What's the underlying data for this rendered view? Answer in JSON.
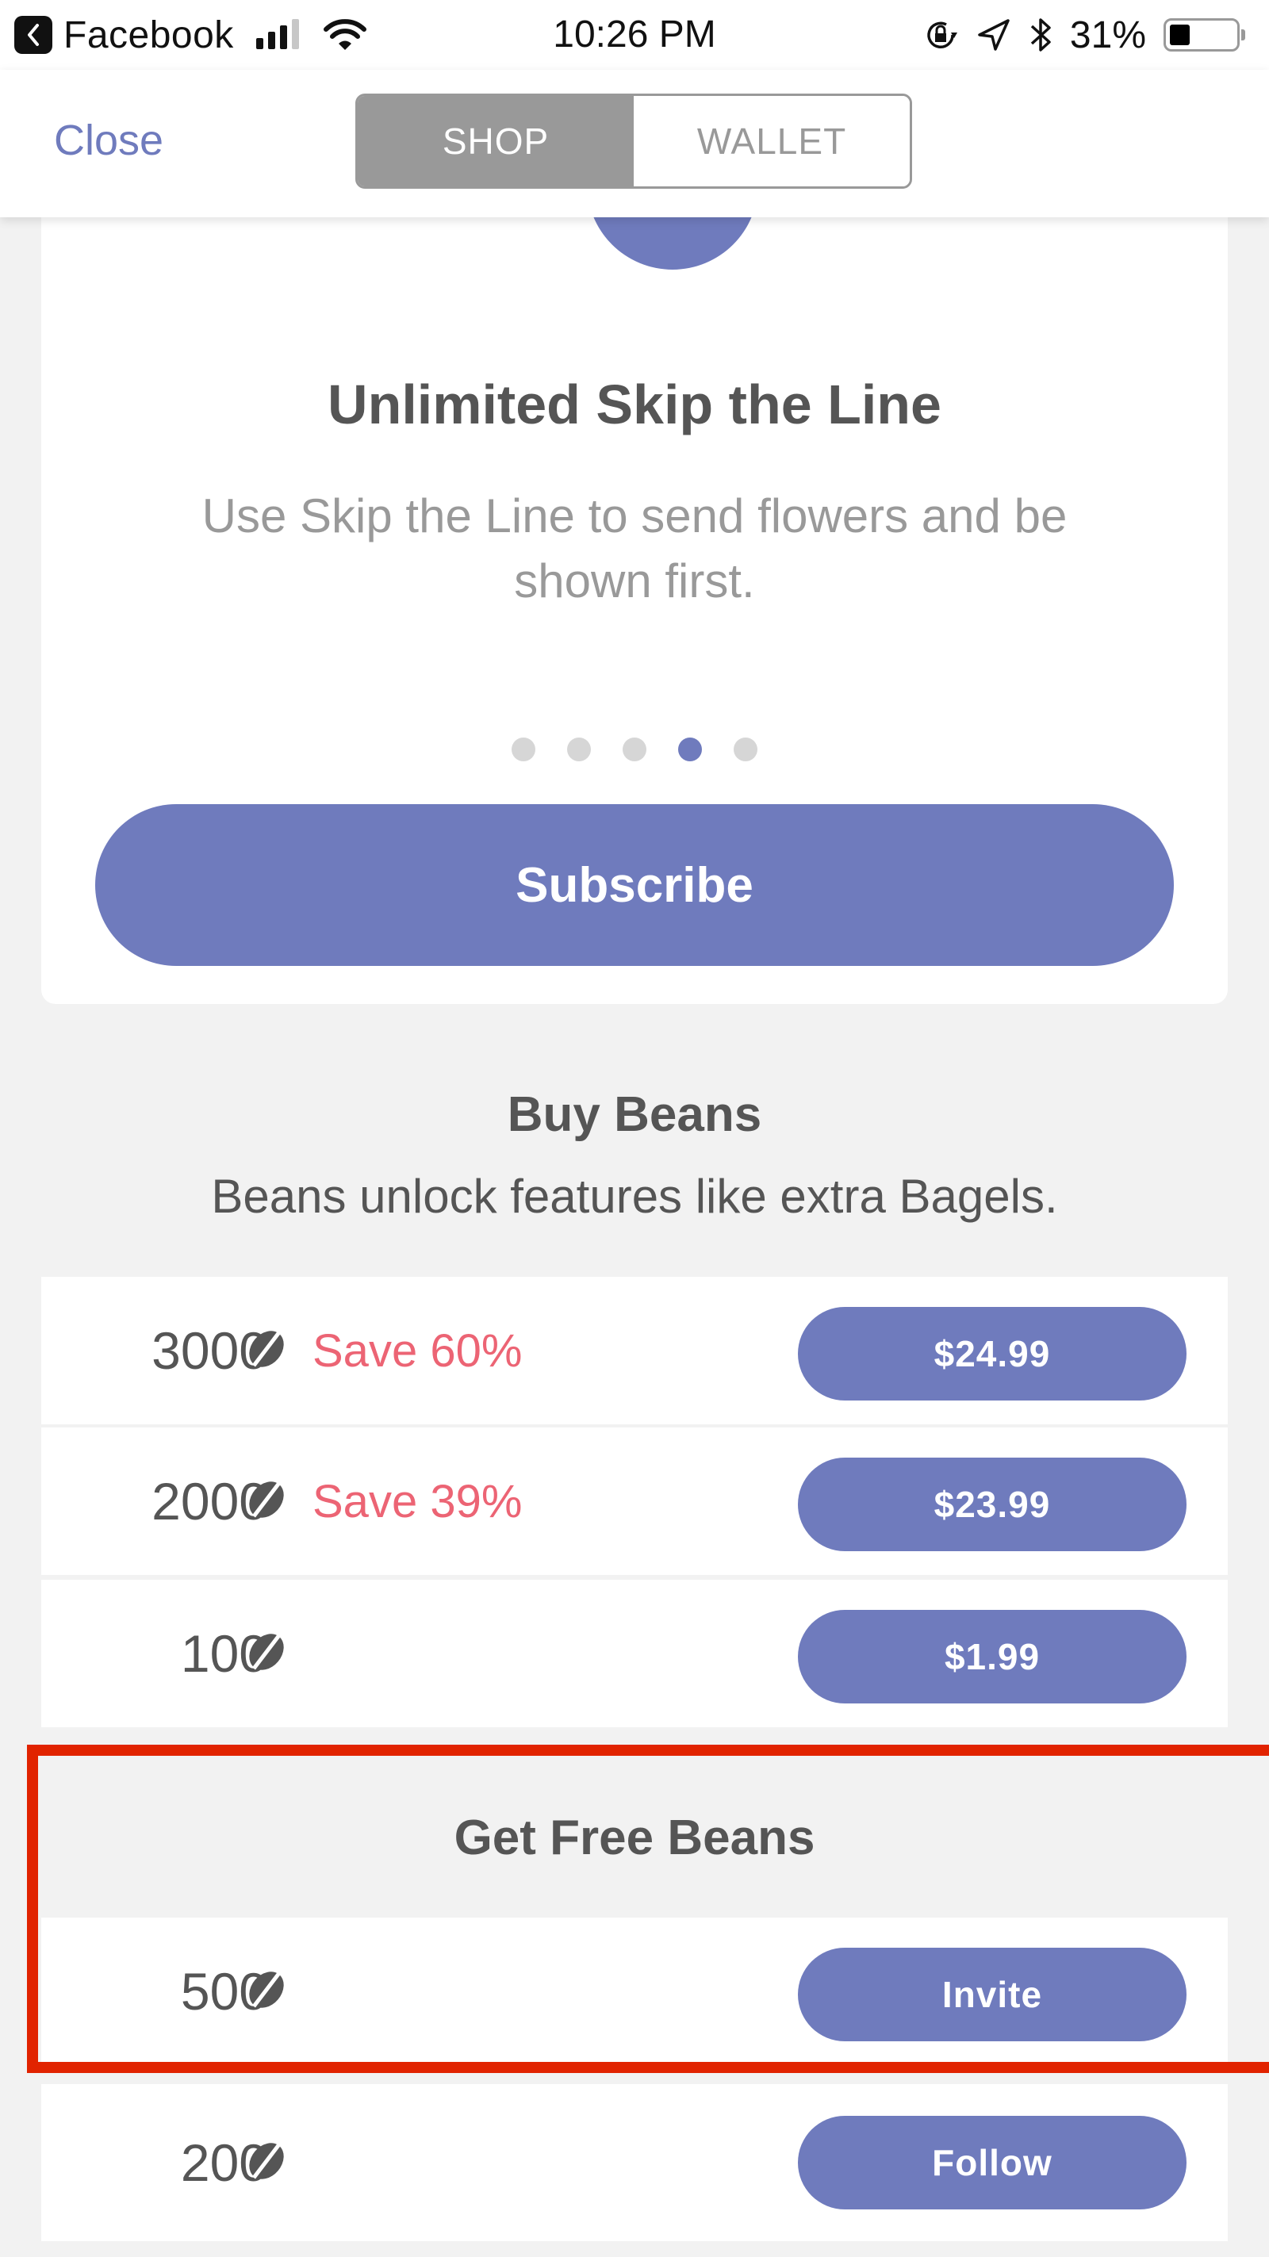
{
  "status_bar": {
    "back_app": "Facebook",
    "time": "10:26 PM",
    "battery_pct": "31%",
    "battery_level": 0.31,
    "signal_bars_on": 3,
    "signal_bars_total": 4,
    "icons": [
      "back-chevron-icon",
      "signal-icon",
      "wifi-icon",
      "orientation-lock-icon",
      "location-arrow-icon",
      "bluetooth-icon",
      "battery-icon"
    ]
  },
  "nav": {
    "close_label": "Close",
    "tabs": [
      {
        "label": "SHOP",
        "active": true
      },
      {
        "label": "WALLET",
        "active": false
      }
    ]
  },
  "promo_card": {
    "title": "Unlimited Skip the Line",
    "description": "Use Skip the Line to send flowers and be shown first.",
    "carousel_total": 5,
    "carousel_active_index": 3,
    "cta_label": "Subscribe"
  },
  "buy_beans": {
    "title": "Buy Beans",
    "subtitle": "Beans unlock features like extra Bagels.",
    "packages": [
      {
        "qty": "3000",
        "save": "Save 60%",
        "price": "$24.99"
      },
      {
        "qty": "2000",
        "save": "Save 39%",
        "price": "$23.99"
      },
      {
        "qty": "100",
        "save": "",
        "price": "$1.99"
      }
    ]
  },
  "free_beans": {
    "title": "Get Free Beans",
    "offers": [
      {
        "qty": "500",
        "action": "Invite"
      },
      {
        "qty": "200",
        "action": "Follow"
      }
    ]
  },
  "colors": {
    "accent": "#6f7bbd",
    "save_text": "#ec6474",
    "highlight_box": "#e12300",
    "segment_active": "#999999",
    "background": "#f2f2f2"
  }
}
